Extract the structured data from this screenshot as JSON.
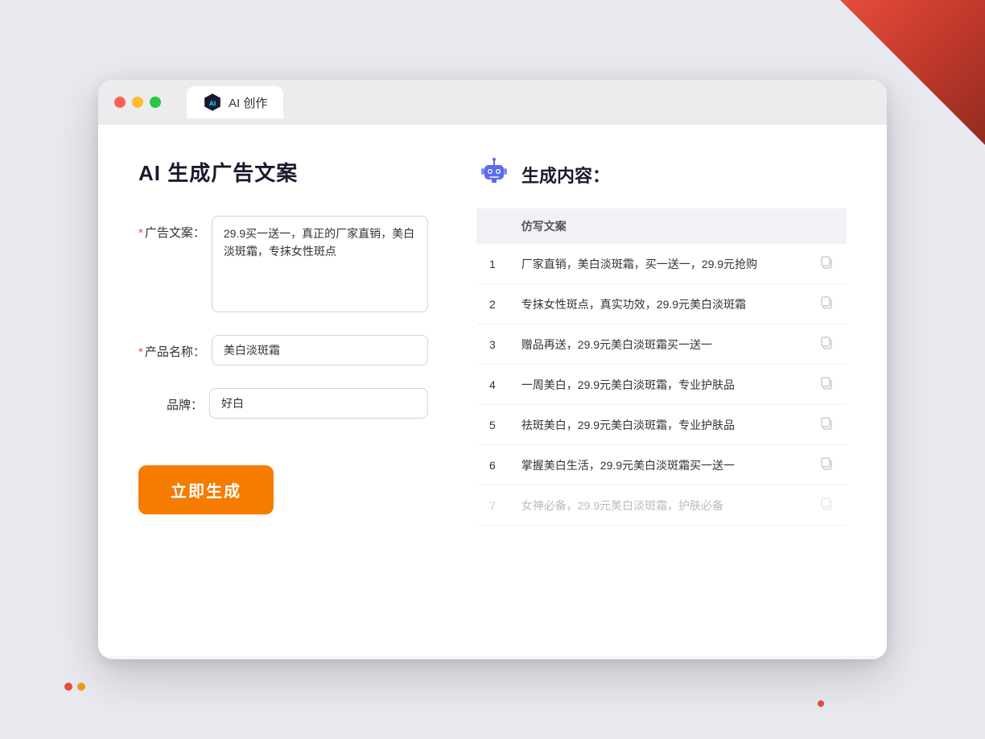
{
  "window": {
    "tab_title": "AI 创作",
    "traffic_lights": [
      "red",
      "yellow",
      "green"
    ]
  },
  "left_panel": {
    "page_title": "AI 生成广告文案",
    "form": {
      "ad_copy_label": "广告文案：",
      "ad_copy_required": true,
      "ad_copy_value": "29.9买一送一，真正的厂家直销，美白淡斑霜，专抹女性斑点",
      "product_name_label": "产品名称：",
      "product_name_required": true,
      "product_name_value": "美白淡斑霜",
      "brand_label": "品牌：",
      "brand_required": false,
      "brand_value": "好白"
    },
    "generate_button": "立即生成"
  },
  "right_panel": {
    "result_label": "生成内容：",
    "table_header": "仿写文案",
    "results": [
      {
        "num": 1,
        "text": "厂家直销，美白淡斑霜，买一送一，29.9元抢购"
      },
      {
        "num": 2,
        "text": "专抹女性斑点，真实功效，29.9元美白淡斑霜"
      },
      {
        "num": 3,
        "text": "赠品再送，29.9元美白淡斑霜买一送一"
      },
      {
        "num": 4,
        "text": "一周美白，29.9元美白淡斑霜，专业护肤品"
      },
      {
        "num": 5,
        "text": "祛斑美白，29.9元美白淡斑霜，专业护肤品"
      },
      {
        "num": 6,
        "text": "掌握美白生活，29.9元美白淡斑霜买一送一"
      },
      {
        "num": 7,
        "text": "女神必备，29.9元美白淡斑霜，护肤必备",
        "faded": true
      }
    ]
  }
}
